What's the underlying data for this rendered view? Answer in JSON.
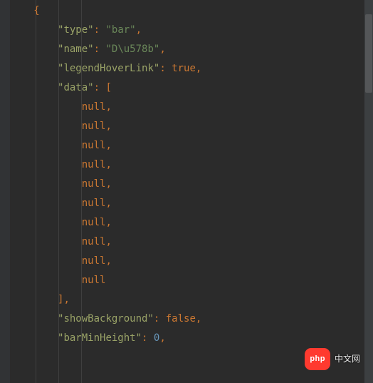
{
  "code": {
    "open_brace": "{",
    "prop_type_key": "\"type\"",
    "prop_type_val": "\"bar\"",
    "prop_name_key": "\"name\"",
    "prop_name_val": "\"D\\u578b\"",
    "prop_legend_key": "\"legendHoverLink\"",
    "prop_legend_val": "true",
    "prop_data_key": "\"data\"",
    "bracket_open": "[",
    "nulls": [
      "null",
      "null",
      "null",
      "null",
      "null",
      "null",
      "null",
      "null",
      "null",
      "null"
    ],
    "bracket_close": "]",
    "prop_showbg_key": "\"showBackground\"",
    "prop_showbg_val": "false",
    "prop_barmin_key": "\"barMinHeight\"",
    "prop_barmin_val": "0",
    "comma": ",",
    "colon": ":"
  },
  "watermark": {
    "pill": "php",
    "text": "中文网"
  }
}
